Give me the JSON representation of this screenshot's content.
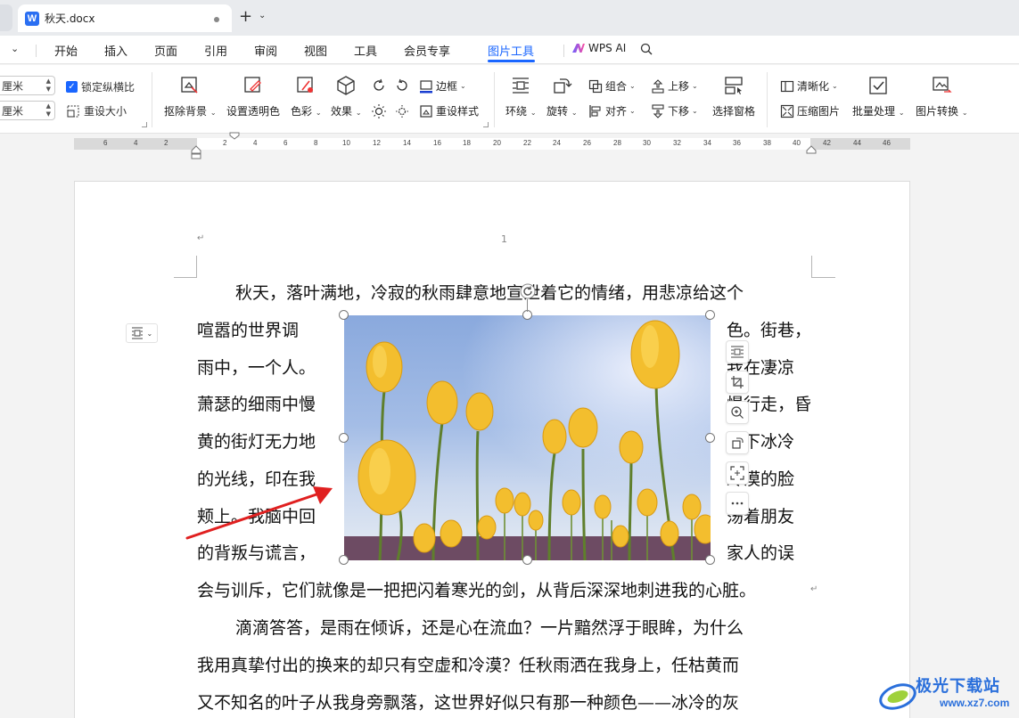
{
  "window": {
    "tab_title": "秋天.docx",
    "new_tab": "+",
    "tab_menu": "⌄"
  },
  "menu": {
    "items": [
      "开始",
      "插入",
      "页面",
      "引用",
      "审阅",
      "视图",
      "工具",
      "会员专享",
      "图片工具"
    ],
    "active": "图片工具",
    "ai_label": "WPS AI",
    "accent": "#1a66ff"
  },
  "ribbon": {
    "height_value": "厘米",
    "width_value": "厘米",
    "lock_ratio": "锁定纵横比",
    "lock_ratio_checked": true,
    "reset_size": "重设大小",
    "remove_bg": "抠除背景",
    "set_transparent": "设置透明色",
    "color": "色彩",
    "effects": "效果",
    "border": "边框",
    "reset_style": "重设样式",
    "wrap": "环绕",
    "rotate": "旋转",
    "group": "组合",
    "align": "对齐",
    "bring_forward": "上移",
    "send_backward": "下移",
    "selection_pane": "选择窗格",
    "sharpen": "清晰化",
    "compress": "压缩图片",
    "batch": "批量处理",
    "convert": "图片转换"
  },
  "ruler": {
    "left_numbers": [
      "6",
      "4",
      "2"
    ],
    "right_numbers": [
      "2",
      "4",
      "6",
      "8",
      "10",
      "12",
      "14",
      "16",
      "18",
      "20",
      "22",
      "24",
      "26",
      "28",
      "30",
      "32",
      "34",
      "36",
      "38",
      "40",
      "42",
      "44",
      "46"
    ]
  },
  "document": {
    "page_number": "1",
    "paragraph_mark": "↵",
    "lines": [
      "秋天，落叶满地，冷寂的秋雨肆意地宣泄着它的情绪，用悲凉给这个",
      "喧嚣的世界调",
      "色。街巷，",
      "雨中，一个人。",
      "我在凄凉",
      "萧瑟的细雨中慢",
      "慢行走，昏",
      "黄的街灯无力地",
      "洒下冰冷",
      "的光线，印在我",
      "冷漠的脸",
      "颊上。我脑中回",
      "荡着朋友",
      "的背叛与谎言，",
      "家人的误",
      "会与训斥，它们就像是一把把闪着寒光的剑，从背后深深地刺进我的心脏。",
      "滴滴答答，是雨在倾诉，还是心在流血？一片黯然浮于眼眸，为什么",
      "我用真挚付出的换来的却只有空虚和冷漠？任秋雨洒在我身上，任枯黄而",
      "又不知名的叶子从我身旁飘落，这世界好似只有那一种颜色——冰冷的灰"
    ]
  },
  "image": {
    "subject": "yellow tulips against blue sky",
    "selected": true
  },
  "watermark": {
    "title": "极光下载站",
    "url": "www.xz7.com"
  }
}
